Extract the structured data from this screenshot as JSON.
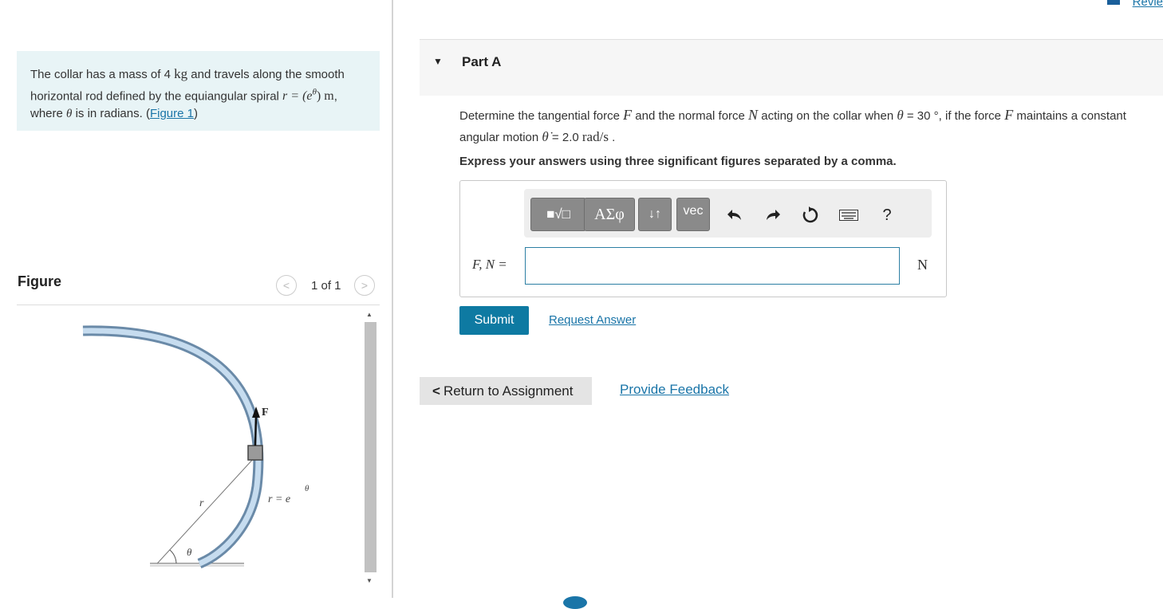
{
  "header": {
    "review_link": "Revie"
  },
  "problem": {
    "text_1": "The collar has a mass of 4 ",
    "mass_unit": "kg",
    "text_2": " and travels along the smooth horizontal rod defined by the equiangular spiral ",
    "equation_lhs": "r = (e",
    "equation_exp": "θ",
    "equation_rhs": ") m",
    "text_3": ", where ",
    "theta": "θ",
    "text_4": " is in radians. (",
    "figure_link": "Figure 1",
    "text_5": ")"
  },
  "figure": {
    "title": "Figure",
    "counter": "1 of 1",
    "labels": {
      "force": "F",
      "radius": "r",
      "spiral": "r = e",
      "spiral_exp": "θ",
      "angle": "θ"
    }
  },
  "part": {
    "title": "Part A"
  },
  "question": {
    "t1": "Determine the tangential force ",
    "F": "F",
    "t2": " and the normal force ",
    "N": "N",
    "t3": " acting on the collar when ",
    "theta": "θ",
    "t4": " = 30 °, if the force ",
    "F2": "F",
    "t5": " maintains a constant angular motion ",
    "theta_dot": "θ̇",
    "t6": " = 2.0 ",
    "rate_unit": "rad/s",
    "t7": " ."
  },
  "instruction": "Express your answers using three significant figures separated by a comma.",
  "toolbar": {
    "templates_label": "■√□",
    "greek_label": "ΑΣφ",
    "arrows_label": "↓↑",
    "vec_label": "vec",
    "help_label": "?"
  },
  "answer": {
    "label": "F, N =",
    "value": "",
    "unit": "N"
  },
  "actions": {
    "submit": "Submit",
    "request_answer": "Request Answer"
  },
  "footer": {
    "return_label": "Return to Assignment",
    "feedback_label": "Provide Feedback"
  }
}
